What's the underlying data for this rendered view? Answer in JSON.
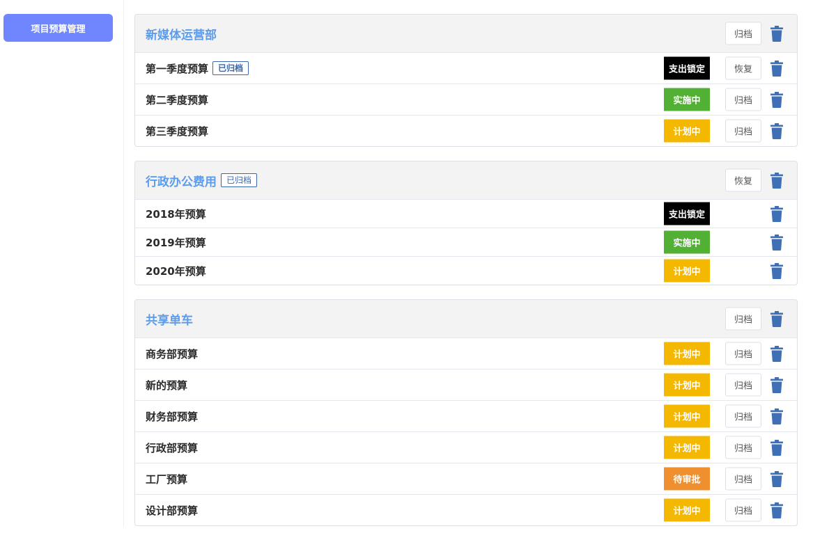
{
  "sidebar": {
    "nav_label": "项目预算管理"
  },
  "colors": {
    "支出锁定": "#000000",
    "实施中": "#52b135",
    "计划中": "#f5b800",
    "待审批": "#ef8f2f"
  },
  "icons": {
    "delete": "trash-icon"
  },
  "groups": [
    {
      "title": "新媒体运营部",
      "archived_tag": "",
      "action": "归档",
      "items": [
        {
          "name": "第一季度预算",
          "tag": "已归档",
          "status": "支出锁定",
          "action": "恢复"
        },
        {
          "name": "第二季度预算",
          "tag": "",
          "status": "实施中",
          "action": "归档"
        },
        {
          "name": "第三季度预算",
          "tag": "",
          "status": "计划中",
          "action": "归档"
        }
      ]
    },
    {
      "title": "行政办公费用",
      "archived_tag": "已归档",
      "action": "恢复",
      "items": [
        {
          "name": "2018年预算",
          "tag": "",
          "status": "支出锁定",
          "action": ""
        },
        {
          "name": "2019年预算",
          "tag": "",
          "status": "实施中",
          "action": ""
        },
        {
          "name": "2020年预算",
          "tag": "",
          "status": "计划中",
          "action": ""
        }
      ]
    },
    {
      "title": "共享单车",
      "archived_tag": "",
      "action": "归档",
      "items": [
        {
          "name": "商务部预算",
          "tag": "",
          "status": "计划中",
          "action": "归档"
        },
        {
          "name": "新的预算",
          "tag": "",
          "status": "计划中",
          "action": "归档"
        },
        {
          "name": "财务部预算",
          "tag": "",
          "status": "计划中",
          "action": "归档"
        },
        {
          "name": "行政部预算",
          "tag": "",
          "status": "计划中",
          "action": "归档"
        },
        {
          "name": "工厂预算",
          "tag": "",
          "status": "待审批",
          "action": "归档"
        },
        {
          "name": "设计部预算",
          "tag": "",
          "status": "计划中",
          "action": "归档"
        }
      ]
    }
  ]
}
